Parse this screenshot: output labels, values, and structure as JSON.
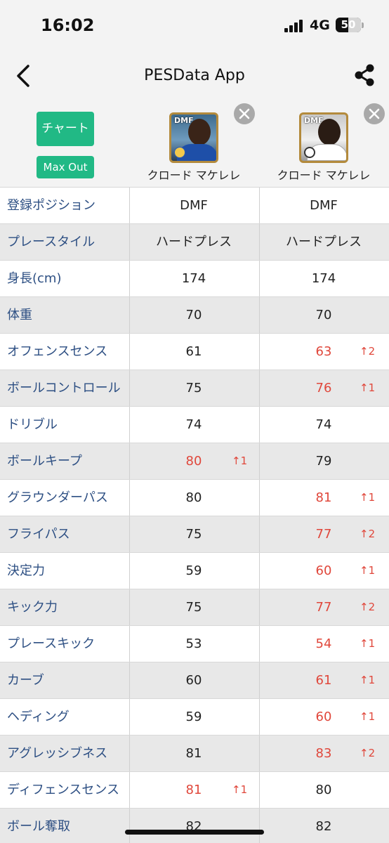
{
  "status_bar": {
    "time": "16:02",
    "network": "4G",
    "battery": "50",
    "battery_level": 0.5
  },
  "nav": {
    "title": "PESData App",
    "back_icon": "chevron-left-icon",
    "share_icon": "share-icon"
  },
  "actions": {
    "chart_label": "チャート",
    "maxout_label": "Max Out"
  },
  "players": [
    {
      "name": "クロード マケレレ",
      "card_label": "DMF"
    },
    {
      "name": "クロード マケレレ",
      "card_label": "DMF"
    }
  ],
  "colors": {
    "accent": "#21b985",
    "label": "#2d4f83",
    "increase": "#e0473b"
  },
  "stats": [
    {
      "label": "登録ポジション",
      "p1": "DMF",
      "p2": "DMF",
      "p1_up": false,
      "p2_up": false,
      "p1_delta": "",
      "p2_delta": ""
    },
    {
      "label": "プレースタイル",
      "p1": "ハードプレス",
      "p2": "ハードプレス",
      "p1_up": false,
      "p2_up": false,
      "p1_delta": "",
      "p2_delta": ""
    },
    {
      "label": "身長(cm)",
      "p1": "174",
      "p2": "174",
      "p1_up": false,
      "p2_up": false,
      "p1_delta": "",
      "p2_delta": ""
    },
    {
      "label": "体重",
      "p1": "70",
      "p2": "70",
      "p1_up": false,
      "p2_up": false,
      "p1_delta": "",
      "p2_delta": ""
    },
    {
      "label": "オフェンスセンス",
      "p1": "61",
      "p2": "63",
      "p1_up": false,
      "p2_up": true,
      "p1_delta": "",
      "p2_delta": "↑2"
    },
    {
      "label": "ボールコントロール",
      "p1": "75",
      "p2": "76",
      "p1_up": false,
      "p2_up": true,
      "p1_delta": "",
      "p2_delta": "↑1"
    },
    {
      "label": "ドリブル",
      "p1": "74",
      "p2": "74",
      "p1_up": false,
      "p2_up": false,
      "p1_delta": "",
      "p2_delta": ""
    },
    {
      "label": "ボールキープ",
      "p1": "80",
      "p2": "79",
      "p1_up": true,
      "p2_up": false,
      "p1_delta": "↑1",
      "p2_delta": ""
    },
    {
      "label": "グラウンダーパス",
      "p1": "80",
      "p2": "81",
      "p1_up": false,
      "p2_up": true,
      "p1_delta": "",
      "p2_delta": "↑1"
    },
    {
      "label": "フライパス",
      "p1": "75",
      "p2": "77",
      "p1_up": false,
      "p2_up": true,
      "p1_delta": "",
      "p2_delta": "↑2"
    },
    {
      "label": "決定力",
      "p1": "59",
      "p2": "60",
      "p1_up": false,
      "p2_up": true,
      "p1_delta": "",
      "p2_delta": "↑1"
    },
    {
      "label": "キック力",
      "p1": "75",
      "p2": "77",
      "p1_up": false,
      "p2_up": true,
      "p1_delta": "",
      "p2_delta": "↑2"
    },
    {
      "label": "プレースキック",
      "p1": "53",
      "p2": "54",
      "p1_up": false,
      "p2_up": true,
      "p1_delta": "",
      "p2_delta": "↑1"
    },
    {
      "label": "カーブ",
      "p1": "60",
      "p2": "61",
      "p1_up": false,
      "p2_up": true,
      "p1_delta": "",
      "p2_delta": "↑1"
    },
    {
      "label": "ヘディング",
      "p1": "59",
      "p2": "60",
      "p1_up": false,
      "p2_up": true,
      "p1_delta": "",
      "p2_delta": "↑1"
    },
    {
      "label": "アグレッシブネス",
      "p1": "81",
      "p2": "83",
      "p1_up": false,
      "p2_up": true,
      "p1_delta": "",
      "p2_delta": "↑2"
    },
    {
      "label": "ディフェンスセンス",
      "p1": "81",
      "p2": "80",
      "p1_up": true,
      "p2_up": false,
      "p1_delta": "↑1",
      "p2_delta": ""
    },
    {
      "label": "ボール奪取",
      "p1": "82",
      "p2": "82",
      "p1_up": false,
      "p2_up": false,
      "p1_delta": "",
      "p2_delta": ""
    }
  ]
}
